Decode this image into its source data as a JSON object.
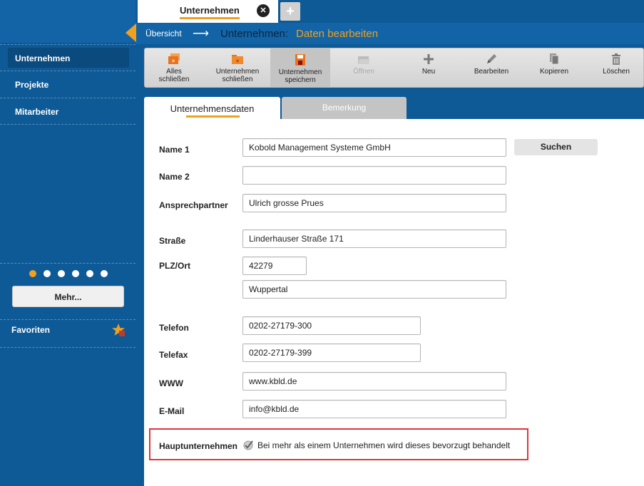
{
  "sidebar": {
    "items": [
      {
        "label": "Unternehmen",
        "active": true
      },
      {
        "label": "Projekte",
        "active": false
      },
      {
        "label": "Mitarbeiter",
        "active": false
      }
    ],
    "more_label": "Mehr...",
    "favorites_label": "Favoriten",
    "pager_dots": 6,
    "pager_active_index": 0
  },
  "doc_tabs": {
    "active_label": "Unternehmen",
    "close_icon": "close-icon",
    "add_icon": "plus-icon"
  },
  "breadcrumb": {
    "home": "Übersicht",
    "arrow": "⟶",
    "current": "Unternehmen:",
    "sub": "Daten bearbeiten"
  },
  "toolbar": {
    "close_all": {
      "line1": "Alles",
      "line2": "schließen",
      "icon": "folder-close-all-icon"
    },
    "close_company": {
      "line1": "Unternehmen",
      "line2": "schließen",
      "icon": "folder-close-icon"
    },
    "save_company": {
      "line1": "Unternehmen",
      "line2": "speichern",
      "icon": "save-icon"
    },
    "open": {
      "line1": "Öffnen",
      "icon": "open-folder-icon"
    },
    "new": {
      "line1": "Neu",
      "icon": "plus-icon"
    },
    "edit": {
      "line1": "Bearbeiten",
      "icon": "pencil-icon"
    },
    "copy": {
      "line1": "Kopieren",
      "icon": "copy-icon"
    },
    "delete": {
      "line1": "Löschen",
      "icon": "trash-icon"
    }
  },
  "subtabs": {
    "company_data": "Unternehmensdaten",
    "remark": "Bemerkung"
  },
  "form": {
    "name1": {
      "label": "Name 1",
      "value": "Kobold Management Systeme GmbH"
    },
    "search_label": "Suchen",
    "name2": {
      "label": "Name 2",
      "value": ""
    },
    "contact": {
      "label": "Ansprechpartner",
      "value": "Ulrich grosse Prues"
    },
    "street": {
      "label": "Straße",
      "value": "Linderhauser Straße 171"
    },
    "zip_city": {
      "label": "PLZ/Ort",
      "zip": "42279",
      "city": "Wuppertal"
    },
    "phone": {
      "label": "Telefon",
      "value": "0202-27179-300"
    },
    "fax": {
      "label": "Telefax",
      "value": "0202-27179-399"
    },
    "www": {
      "label": "WWW",
      "value": "www.kbld.de"
    },
    "email": {
      "label": "E-Mail",
      "value": "info@kbld.de"
    },
    "main_company": {
      "label": "Hauptunternehmen",
      "checkbox_text": "Bei mehr als einem Unternehmen wird dieses bevorzugt behandelt",
      "checked": true
    }
  },
  "colors": {
    "sidebar_bg": "#0d5a96",
    "header_bg": "#1264a6",
    "accent": "#f0a020",
    "highlight_border": "#e0343c"
  }
}
